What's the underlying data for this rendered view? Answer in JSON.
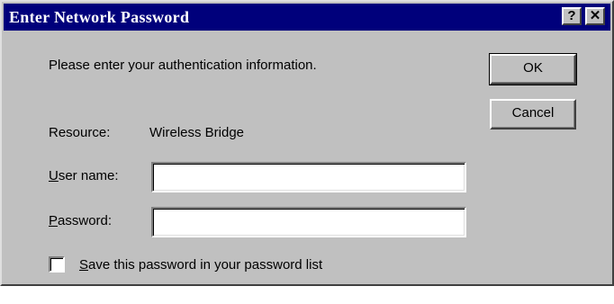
{
  "dialog": {
    "title": "Enter Network Password",
    "help_button": "?",
    "close_button": "✕",
    "prompt": "Please enter your authentication information.",
    "resource_label": "Resource:",
    "resource_value": "Wireless Bridge",
    "username_label_key": "U",
    "username_label_rest": "ser name:",
    "username_value": "",
    "password_label_key": "P",
    "password_label_rest": "assword:",
    "password_value": "",
    "save_password_key": "S",
    "save_password_rest": "ave this password in your password list",
    "save_password_checked": false,
    "ok_label": "OK",
    "cancel_label": "Cancel"
  },
  "colors": {
    "titlebar": "#00007b",
    "window": "#c0c0c0"
  }
}
